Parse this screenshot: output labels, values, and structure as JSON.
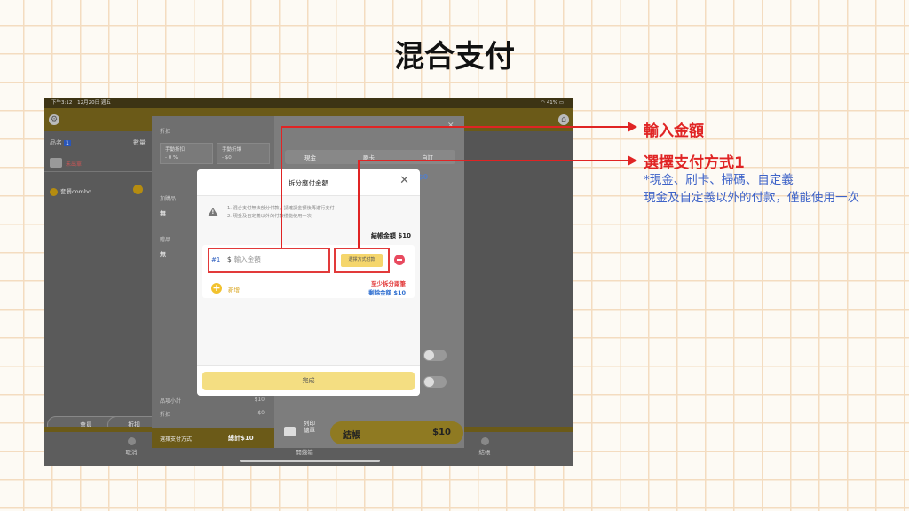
{
  "slide": {
    "title": "混合支付"
  },
  "annotations": {
    "label1": "輸入金額",
    "label2": "選擇支付方式1",
    "desc1": "*現金、刷卡、掃碼、自定義",
    "desc2": "現金及自定義以外的付款，僅能使用一次",
    "color": "#e02424",
    "desc_color": "#3e63c8"
  },
  "statusbar": {
    "time": "下午3:12",
    "date": "12月20日 週五",
    "battery": "41%"
  },
  "left_panel": {
    "col_name": "品名",
    "count_badge": "1",
    "col_qty": "數量",
    "unsent": "未出單",
    "item": "套餐combo",
    "item_qty": "1",
    "member_btn": "會員",
    "discount_btn": "折扣"
  },
  "bottom_bar": {
    "cancel": "取消",
    "side": "開錢箱",
    "checkout_tab": "結帳"
  },
  "sheet": {
    "discount_label": "折扣",
    "manual_pct_label": "手動折扣",
    "manual_pct_val": "- 0 %",
    "manual_amt_label": "手動折讓",
    "manual_amt_val": "- $0",
    "addon_label": "加購品",
    "addon_val": "無",
    "gift_label": "贈品",
    "gift_val": "無",
    "tab_cash": "現金",
    "tab_card": "刷卡",
    "tab_custom": "自訂",
    "amount_hint": "$0",
    "subtotal_label": "品項小計",
    "subtotal_val": "$10",
    "discount_sum_label": "折扣",
    "discount_sum_val": "-$0",
    "paymethod_label": "選擇支付方式",
    "total_label": "總計$10",
    "print_label_1": "列印",
    "print_label_2": "總單",
    "checkout_label": "結帳",
    "checkout_amount": "$10"
  },
  "modal": {
    "title": "拆分應付金額",
    "close": "✕",
    "notice_line1": "1. 混合支付無法部分付款，請確認金額後再進行支付",
    "notice_line2": "2. 現金及自定義以外的付款僅能使用一次",
    "total_line": "結帳金額 $10",
    "row_index": "#1",
    "currency": "$",
    "amount_placeholder": "輸入金額",
    "method_button": "選擇方式付款",
    "add_label": "新增",
    "min_split": "至少拆分兩筆",
    "remaining": "剩餘金額 $10",
    "done": "完成"
  }
}
